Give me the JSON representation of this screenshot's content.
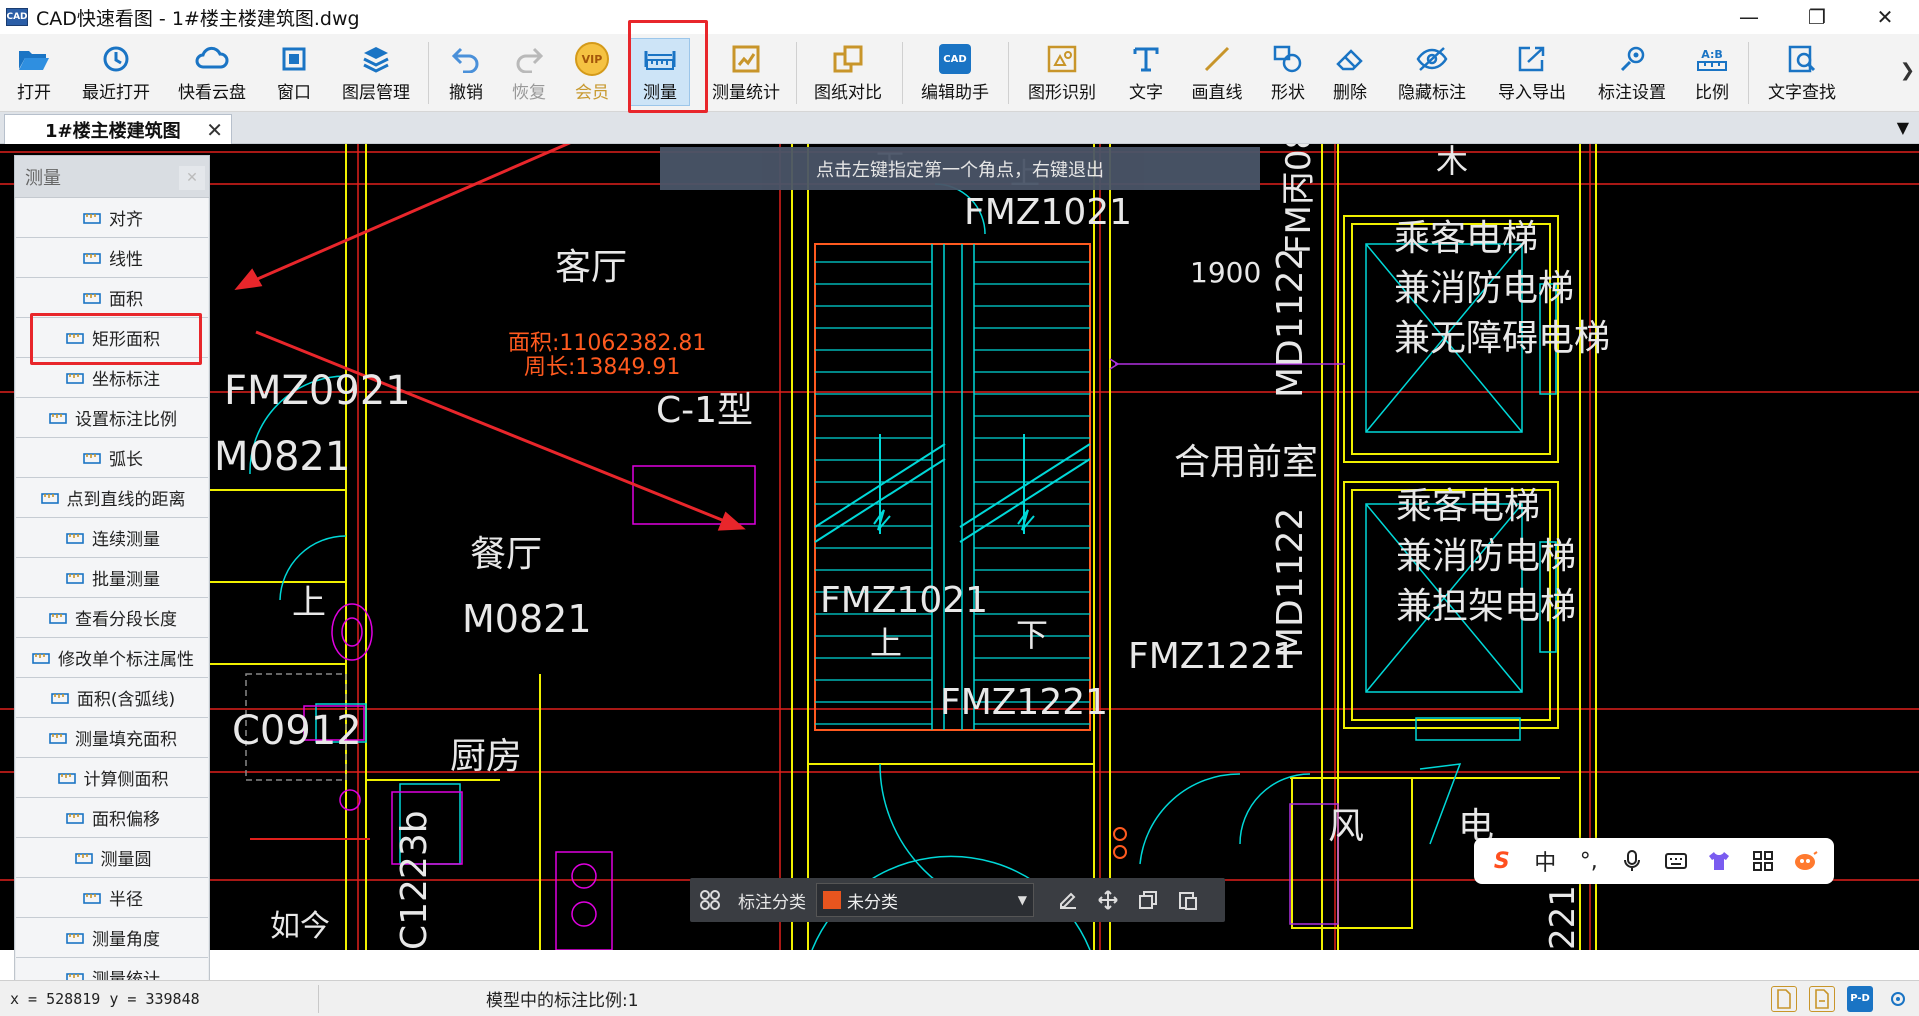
{
  "window": {
    "app_icon_text": "CAD",
    "title": "CAD快速看图 - 1#楼主楼建筑图.dwg",
    "minimize": "—",
    "restore": "❐",
    "close": "✕"
  },
  "toolbar": {
    "items": [
      {
        "id": "open",
        "label": "打开",
        "icon": "folder-open-icon"
      },
      {
        "id": "recent",
        "label": "最近打开",
        "icon": "clock-icon"
      },
      {
        "id": "cloud",
        "label": "快看云盘",
        "icon": "cloud-icon"
      },
      {
        "id": "window",
        "label": "窗口",
        "icon": "window-icon"
      },
      {
        "id": "layers",
        "label": "图层管理",
        "icon": "layers-icon"
      },
      {
        "id": "undo",
        "label": "撤销",
        "icon": "undo-icon"
      },
      {
        "id": "redo",
        "label": "恢复",
        "icon": "redo-icon"
      },
      {
        "id": "vip",
        "label": "会员",
        "icon": "vip-icon",
        "icon_text": "VIP"
      },
      {
        "id": "measure",
        "label": "测量",
        "icon": "ruler-icon"
      },
      {
        "id": "measure_stats",
        "label": "测量统计",
        "icon": "measure-stats-icon"
      },
      {
        "id": "compare",
        "label": "图纸对比",
        "icon": "compare-icon"
      },
      {
        "id": "edit_helper",
        "label": "编辑助手",
        "icon": "cad-edit-icon",
        "icon_text": "CAD"
      },
      {
        "id": "shape_recog",
        "label": "图形识别",
        "icon": "shape-recognition-icon"
      },
      {
        "id": "text",
        "label": "文字",
        "icon": "text-icon"
      },
      {
        "id": "line",
        "label": "画直线",
        "icon": "line-icon"
      },
      {
        "id": "shape",
        "label": "形状",
        "icon": "shape-icon"
      },
      {
        "id": "delete",
        "label": "删除",
        "icon": "eraser-icon"
      },
      {
        "id": "hide_anno",
        "label": "隐藏标注",
        "icon": "eye-hidden-icon"
      },
      {
        "id": "import_export",
        "label": "导入导出",
        "icon": "import-export-icon"
      },
      {
        "id": "anno_settings",
        "label": "标注设置",
        "icon": "settings-icon"
      },
      {
        "id": "scale",
        "label": "比例",
        "icon": "scale-icon",
        "icon_text": "A:B"
      },
      {
        "id": "text_search",
        "label": "文字查找",
        "icon": "text-search-icon"
      }
    ],
    "more": "❯"
  },
  "tabs": {
    "active_label": "1#楼主楼建筑图",
    "close": "✕",
    "dropdown": "▼"
  },
  "hint": "点击左键指定第一个角点，右键退出",
  "measure_panel": {
    "title": "测量",
    "close": "✕",
    "items": [
      {
        "label": "对齐",
        "icon": "align-measure-icon"
      },
      {
        "label": "线性",
        "icon": "linear-measure-icon"
      },
      {
        "label": "面积",
        "icon": "area-icon"
      },
      {
        "label": "矩形面积",
        "icon": "rect-area-icon"
      },
      {
        "label": "坐标标注",
        "icon": "coordinate-icon"
      },
      {
        "label": "设置标注比例",
        "icon": "scale-setting-icon"
      },
      {
        "label": "弧长",
        "icon": "arc-length-icon"
      },
      {
        "label": "点到直线的距离",
        "icon": "point-line-icon"
      },
      {
        "label": "连续测量",
        "icon": "continuous-measure-icon"
      },
      {
        "label": "批量测量",
        "icon": "batch-measure-icon"
      },
      {
        "label": "查看分段长度",
        "icon": "segment-length-icon"
      },
      {
        "label": "修改单个标注属性",
        "icon": "edit-annotation-icon"
      },
      {
        "label": "面积(含弧线)",
        "icon": "area-arc-icon"
      },
      {
        "label": "测量填充面积",
        "icon": "fill-area-icon"
      },
      {
        "label": "计算侧面积",
        "icon": "side-area-icon"
      },
      {
        "label": "面积偏移",
        "icon": "area-offset-icon"
      },
      {
        "label": "测量圆",
        "icon": "circle-measure-icon"
      },
      {
        "label": "半径",
        "icon": "radius-icon"
      },
      {
        "label": "测量角度",
        "icon": "angle-icon"
      },
      {
        "label": "测量统计",
        "icon": "stats-icon"
      }
    ]
  },
  "drawing": {
    "room_living": "客厅",
    "area_text": "面积:11062382.81",
    "perimeter_text": "周长:13849.91",
    "door_fmz0921": "FMZ0921",
    "door_m0821_a": "M0821",
    "dining": "餐厅",
    "door_m0821_b": "M0821",
    "kitchen": "厨房",
    "window_c0912": "C0912",
    "type_c1": "C-1型",
    "stair_up_top": "上",
    "stair_down_top": "下",
    "door_fmz1021_top": "FMZ1021",
    "door_fmz1021_bottom": "FMZ1021",
    "stair_up_bottom": "上",
    "stair_down_bottom": "下",
    "door_fmz1221_a": "FMZ1221",
    "door_fmz1221_b": "FMZ1221",
    "dim_1900": "1900",
    "door_md1122_a": "MD1122",
    "door_md1122_b": "MD1122",
    "lobby": "合用前室",
    "elevator1_l1": "乘客电梯",
    "elevator1_l2": "兼消防电梯",
    "elevator1_l3": "兼无障碍电梯",
    "elevator2_l1": "乘客电梯",
    "elevator2_l2": "兼消防电梯",
    "elevator2_l3": "兼担架电梯",
    "wind": "风",
    "elec": "电",
    "fm_top": "FM丙08",
    "misc_top": "木",
    "vert_text": "C1223b",
    "left_small": "上",
    "bottom_char": "如今",
    "bottom_right_num": "221",
    "colors": {
      "wall": "#f0f000",
      "cyan": "#00d8d8",
      "red": "#e0201c",
      "orange": "#ff5a1f",
      "magenta": "#e000e0",
      "white": "#e8e8e8"
    }
  },
  "anno_bar": {
    "label": "标注分类",
    "selected": "未分类",
    "swatch_color": "#e8551f"
  },
  "ime": {
    "logo": "S",
    "mode": "中",
    "punct": "°,"
  },
  "status": {
    "coords": "x = 528819  y = 339848",
    "scale_text": "模型中的标注比例:1"
  }
}
